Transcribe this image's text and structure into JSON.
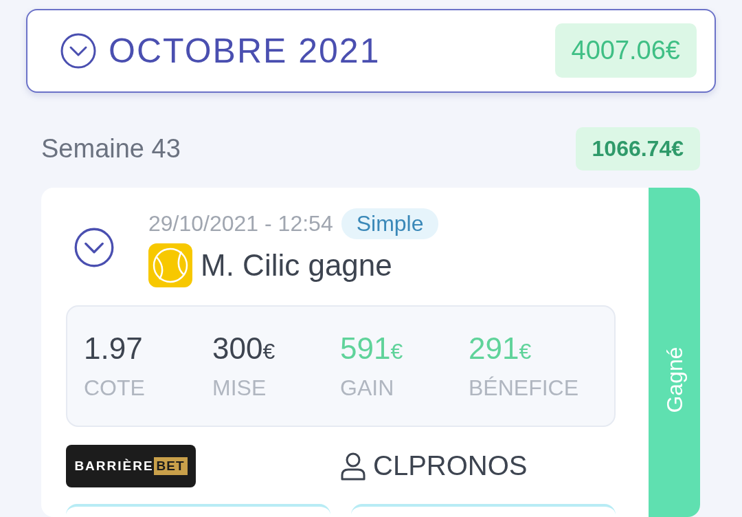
{
  "month": {
    "title": "OCTOBRE 2021",
    "total": "4007.06€"
  },
  "week": {
    "title": "Semaine 43",
    "total": "1066.74€"
  },
  "bet": {
    "datetime": "29/10/2021 - 12:54",
    "type": "Simple",
    "title": "M. Cilic gagne",
    "stats": [
      {
        "value": "1.97",
        "label": "COTE",
        "highlight": false
      },
      {
        "value": "300",
        "unit": "€",
        "label": "MISE",
        "highlight": false
      },
      {
        "value": "591",
        "unit": "€",
        "label": "GAIN",
        "highlight": true
      },
      {
        "value": "291",
        "unit": "€",
        "label": "BÉNEFICE",
        "highlight": true
      }
    ],
    "bookmaker": {
      "name": "BARRIÈRE",
      "accent": "BET"
    },
    "tipster": "CLPRONOS",
    "status": {
      "label": "Gagné",
      "kind": "won"
    }
  }
}
